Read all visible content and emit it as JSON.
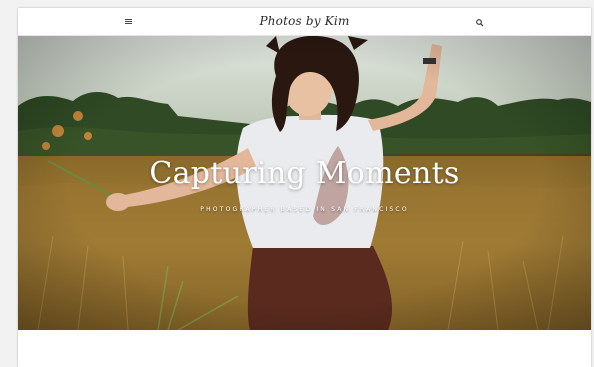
{
  "header": {
    "site_title": "Photos by Kim",
    "menu_icon": "hamburger-menu-icon",
    "search_icon": "search-icon"
  },
  "hero": {
    "title": "Capturing Moments",
    "subtitle": "PHOTOGRAPHER BASED IN SAN FRANCISCO",
    "image": "woman-in-golden-grass-field-photo"
  },
  "colors": {
    "page_background": "#f2f2f2",
    "header_background": "#ffffff",
    "hero_text": "#ffffff"
  }
}
